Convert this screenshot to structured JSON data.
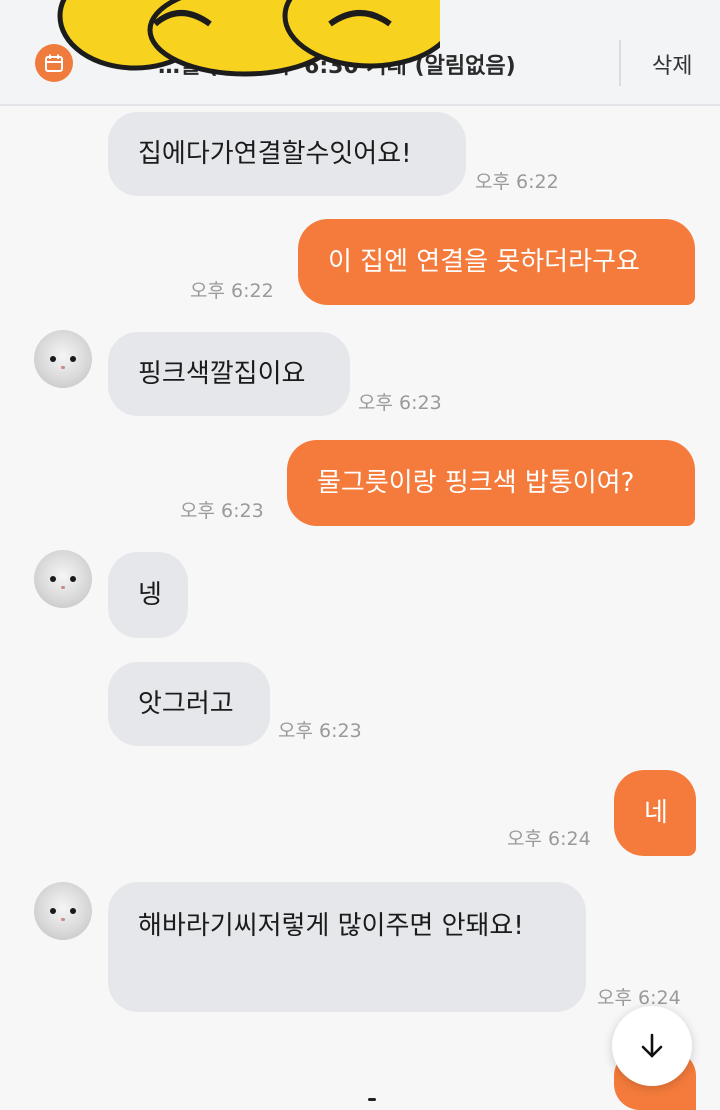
{
  "header": {
    "title": "…월 (화) 오후 6:30 거래 (알림없음)",
    "delete_label": "삭제",
    "icon": "calendar-icon",
    "accent": "#ef7b3c"
  },
  "messages": [
    {
      "side": "in",
      "text": "집에다가연결할수잇어요!",
      "time": "오후 6:22",
      "avatar": false
    },
    {
      "side": "out",
      "text": "이 집엔 연결을 못하더라구요",
      "time": "오후 6:22"
    },
    {
      "side": "in",
      "text": "핑크색깔집이요",
      "time": "오후 6:23",
      "avatar": true
    },
    {
      "side": "out",
      "text": "물그릇이랑 핑크색 밥통이여?",
      "time": "오후 6:23"
    },
    {
      "side": "in",
      "text": "넹",
      "time": "",
      "avatar": true
    },
    {
      "side": "in",
      "text": "앗그러고",
      "time": "오후 6:23",
      "avatar": false
    },
    {
      "side": "out",
      "text": "네",
      "time": "오후 6:24"
    },
    {
      "side": "in",
      "text": "해바라기씨저렇게 많이주면 안돼요!",
      "time": "오후 6:24",
      "avatar": true
    }
  ],
  "controls": {
    "scroll_down_icon": "arrow-down-icon"
  },
  "colors": {
    "outgoing_bubble": "#f47b3b",
    "incoming_bubble": "#e6e7eb",
    "timestamp": "#9a9a9a"
  }
}
